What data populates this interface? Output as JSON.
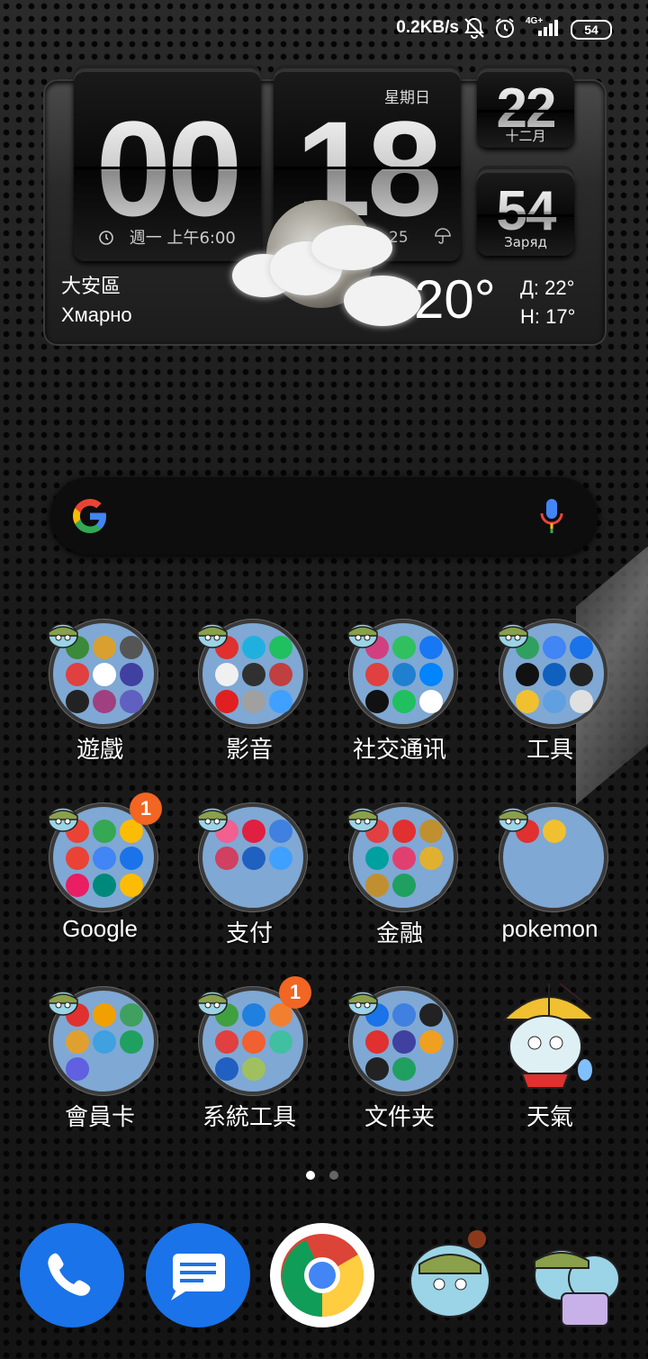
{
  "status_bar": {
    "net_speed": "0.2KB/s",
    "network": "4G+",
    "battery": "54"
  },
  "clock": {
    "hour": "00",
    "minute": "18",
    "weekday": "星期日",
    "date_day": "22",
    "date_month": "十二月",
    "seconds": "54",
    "charge_label": "Заряд",
    "alarm_text": "週一 上午6:00",
    "minute_extra": "25"
  },
  "weather": {
    "location": "大安區",
    "condition": "Хмарно",
    "temperature": "20°",
    "high": "Д: 22°",
    "low": "Н: 17°"
  },
  "search": {
    "placeholder": ""
  },
  "folders": [
    {
      "label": "遊戲"
    },
    {
      "label": "影音"
    },
    {
      "label": "社交通讯"
    },
    {
      "label": "工具"
    },
    {
      "label": "Google",
      "badge": "1"
    },
    {
      "label": "支付"
    },
    {
      "label": "金融"
    },
    {
      "label": "pokemon"
    },
    {
      "label": "會員卡"
    },
    {
      "label": "系統工具",
      "badge": "1"
    },
    {
      "label": "文件夹"
    },
    {
      "label": "天氣"
    }
  ],
  "pages": {
    "count": 2,
    "current": 1
  },
  "dock": [
    {
      "name": "phone-app"
    },
    {
      "name": "messages-app"
    },
    {
      "name": "chrome-app"
    },
    {
      "name": "mascot-app-1"
    },
    {
      "name": "mascot-app-2"
    }
  ],
  "colors": {
    "folder_bg": "#7fa8d4",
    "badge": "#f26522",
    "accent_blue": "#1a73e8"
  },
  "icons": [
    "alarm-muted-icon",
    "alarm-clock-icon",
    "signal-icon",
    "battery-icon",
    "google-g-icon",
    "mic-icon",
    "umbrella-icon"
  ]
}
